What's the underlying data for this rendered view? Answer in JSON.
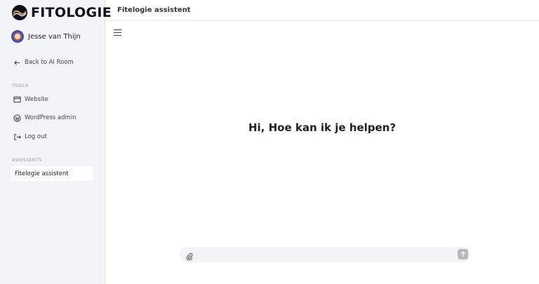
{
  "brand": {
    "name": "FITOLOGIE",
    "accent": "#d9a74a"
  },
  "user": {
    "name": "Jesse van Thijn"
  },
  "sidebar": {
    "back_link": "Back to AI Room",
    "tools_label": "TOOLS",
    "tools": [
      {
        "label": "Website",
        "icon": "browser-window-icon"
      },
      {
        "label": "WordPress admin",
        "icon": "wordpress-icon"
      },
      {
        "label": "Log out",
        "icon": "logout-icon"
      }
    ],
    "assistants_label": "ASSISTANTS",
    "assistants": [
      {
        "label": "Fitelogie assistent",
        "active": true
      }
    ]
  },
  "header": {
    "title": "Fitelogie assistent"
  },
  "main": {
    "greeting": "Hi, Hoe kan ik je helpen?"
  },
  "composer": {
    "value": "",
    "placeholder": ""
  }
}
